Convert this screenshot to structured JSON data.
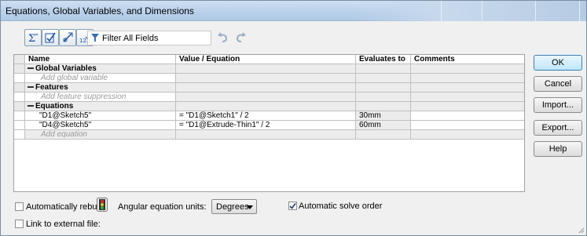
{
  "window": {
    "title": "Equations, Global Variables, and Dimensions"
  },
  "toolbar": {
    "buttons": [
      {
        "name": "sum-icon"
      },
      {
        "name": "check-edit-icon"
      },
      {
        "name": "dimension-icon"
      },
      {
        "name": "sort-order-icon"
      }
    ],
    "filter_label": "Filter All Fields",
    "undo_icon": "undo-icon",
    "redo_icon": "redo-icon"
  },
  "table": {
    "headers": {
      "name": "Name",
      "value": "Value / Equation",
      "evaluates": "Evaluates to",
      "comments": "Comments"
    },
    "sections": {
      "global": {
        "label": "Global Variables",
        "placeholder": "Add global variable"
      },
      "features": {
        "label": "Features",
        "placeholder": "Add feature suppression"
      },
      "equations": {
        "label": "Equations",
        "placeholder": "Add equation"
      }
    },
    "rows": [
      {
        "name": "\"D1@Sketch5\"",
        "value": "= \"D1@Sketch1\" / 2",
        "evaluates": "30mm",
        "comment": ""
      },
      {
        "name": "\"D4@Sketch5\"",
        "value": "= \"D1@Extrude-Thin1\" / 2",
        "evaluates": "60mm",
        "comment": ""
      }
    ]
  },
  "buttons": {
    "ok": "OK",
    "cancel": "Cancel",
    "import": "Import...",
    "export": "Export...",
    "help": "Help"
  },
  "options": {
    "auto_rebuild": {
      "label": "Automatically rebuild",
      "checked": false
    },
    "angular_units_label": "Angular equation units:",
    "angular_units_value": "Degrees",
    "auto_solve": {
      "label": "Automatic solve order",
      "checked": true
    },
    "link_external": {
      "label": "Link to external file:",
      "checked": false
    }
  },
  "colors": {
    "title_bar": "#bdd3ec",
    "ok_button": "#bee6fd",
    "placeholder": "#9a9a9a"
  }
}
